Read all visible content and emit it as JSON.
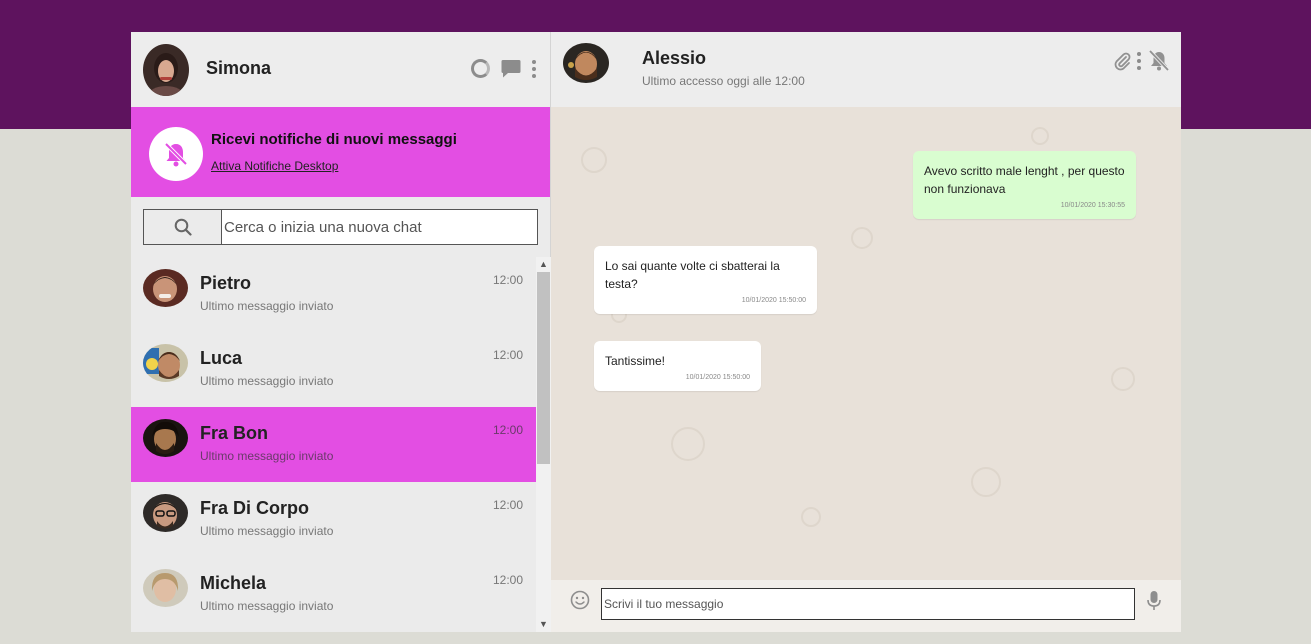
{
  "me": {
    "name": "Simona"
  },
  "left_header": {
    "icons": [
      "status-ring-icon",
      "new-chat-icon",
      "menu-dots-icon"
    ]
  },
  "notification": {
    "icon": "bell-off-icon",
    "title": "Ricevi notifiche di nuovi messaggi",
    "link": "Attiva Notifiche Desktop"
  },
  "search": {
    "icon": "search-icon",
    "placeholder": "Cerca o inizia una nuova chat"
  },
  "contacts": [
    {
      "name": "Pietro",
      "last_message": "Ultimo messaggio inviato",
      "time": "12:00",
      "active": false
    },
    {
      "name": "Luca",
      "last_message": "Ultimo messaggio inviato",
      "time": "12:00",
      "active": false
    },
    {
      "name": "Fra Bon",
      "last_message": "Ultimo messaggio inviato",
      "time": "12:00",
      "active": true
    },
    {
      "name": "Fra Di Corpo",
      "last_message": "Ultimo messaggio inviato",
      "time": "12:00",
      "active": false
    },
    {
      "name": "Michela",
      "last_message": "Ultimo messaggio inviato",
      "time": "12:00",
      "active": false
    }
  ],
  "chat_header": {
    "name": "Alessio",
    "status": "Ultimo accesso oggi alle 12:00",
    "icons": [
      "paperclip-icon",
      "menu-dots-icon",
      "bell-off-icon"
    ]
  },
  "messages": [
    {
      "direction": "sent",
      "text": "Avevo scritto male lenght , per questo non funzionava",
      "time": "10/01/2020 15:30:55"
    },
    {
      "direction": "received",
      "text": "Lo sai quante volte ci sbatterai la testa?",
      "time": "10/01/2020 15:50:00"
    },
    {
      "direction": "received",
      "text": "Tantissime!",
      "time": "10/01/2020 15:50:00"
    }
  ],
  "compose": {
    "placeholder": "Scrivi il tuo messaggio",
    "emoji_icon": "emoji-icon",
    "mic_icon": "microphone-icon"
  },
  "colors": {
    "top_band": "#5e135e",
    "accent": "#e34ee3",
    "sent_bubble": "#d9fdd0",
    "received_bubble": "#ffffff",
    "chat_background": "#e8e1d9"
  }
}
